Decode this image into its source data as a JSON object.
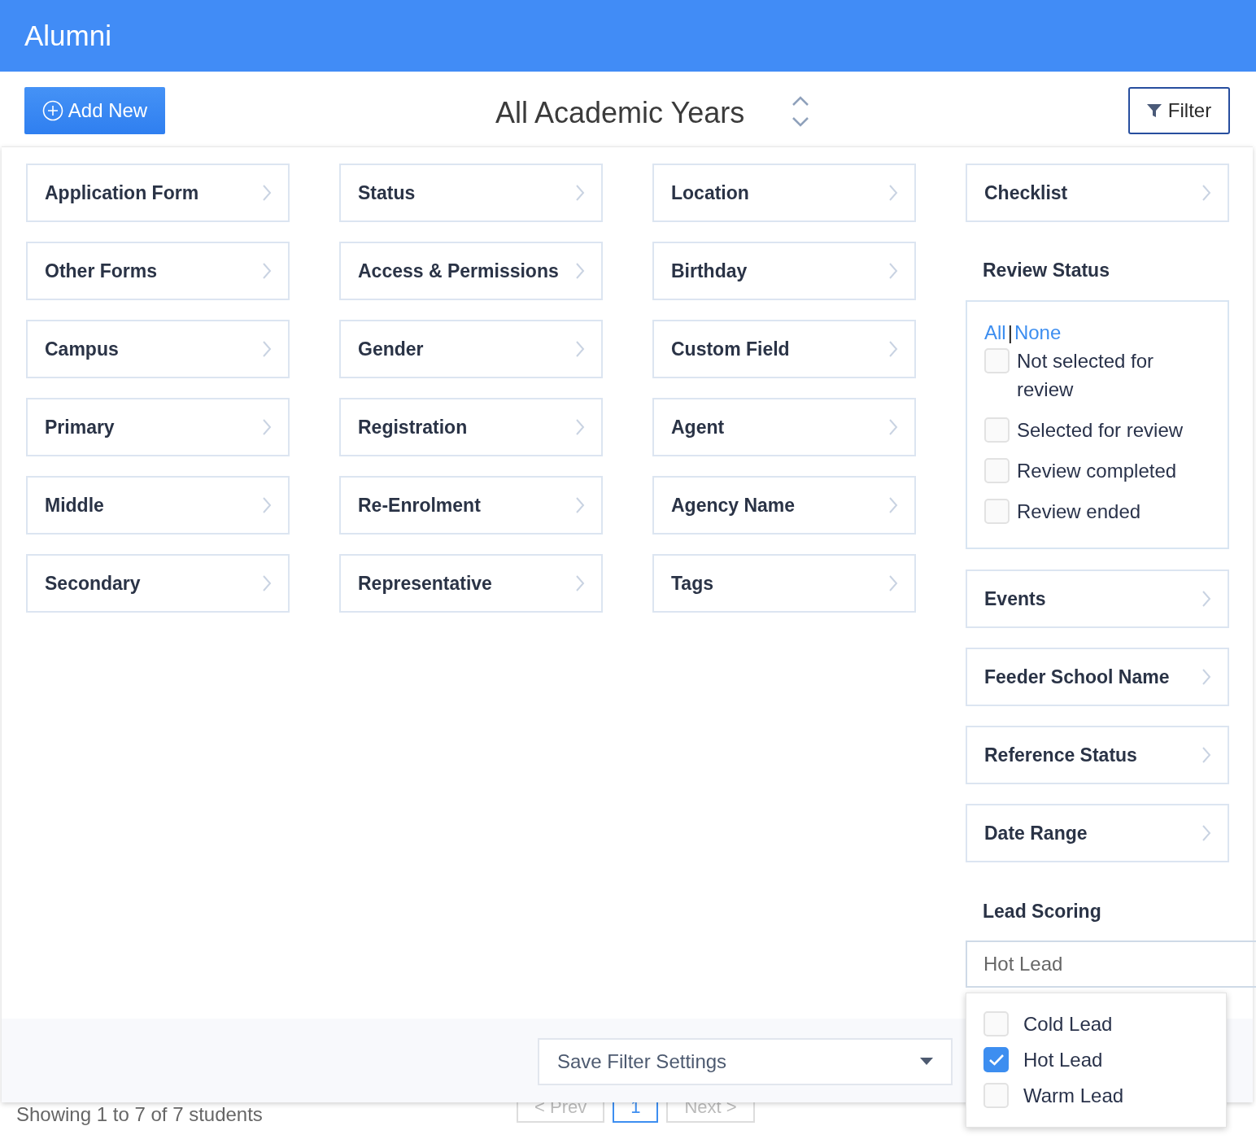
{
  "header": {
    "title": "Alumni"
  },
  "toolbar": {
    "add_button": "Add New",
    "year_selector": "All Academic Years",
    "filter_button": "Filter"
  },
  "filter_columns": [
    [
      "Application Form",
      "Other Forms",
      "Campus",
      "Primary",
      "Middle",
      "Secondary"
    ],
    [
      "Status",
      "Access & Permissions",
      "Gender",
      "Registration",
      "Re-Enrolment",
      "Representative"
    ],
    [
      "Location",
      "Birthday",
      "Custom Field",
      "Agent",
      "Agency Name",
      "Tags"
    ]
  ],
  "checklist": "Checklist",
  "review_status": {
    "title": "Review Status",
    "all_link": "All",
    "separator": "|",
    "none_link": "None",
    "options": [
      {
        "label": "Not selected for review",
        "checked": false
      },
      {
        "label": "Selected for review",
        "checked": false
      },
      {
        "label": "Review completed",
        "checked": false
      },
      {
        "label": "Review ended",
        "checked": false
      }
    ]
  },
  "more_filters": [
    "Events",
    "Feeder School Name",
    "Reference Status",
    "Date Range"
  ],
  "lead_scoring": {
    "title": "Lead Scoring",
    "value": "Hot Lead",
    "options": [
      {
        "label": "Cold Lead",
        "checked": false
      },
      {
        "label": "Hot Lead",
        "checked": true
      },
      {
        "label": "Warm Lead",
        "checked": false
      }
    ]
  },
  "save_settings": {
    "value": "Save Filter Settings"
  },
  "background": {
    "summary": "Showing 1 to 7 of 7 students",
    "pagination": [
      {
        "label": "< Prev",
        "selected": false
      },
      {
        "label": "1",
        "selected": true
      },
      {
        "label": "Next >",
        "selected": false
      }
    ]
  }
}
